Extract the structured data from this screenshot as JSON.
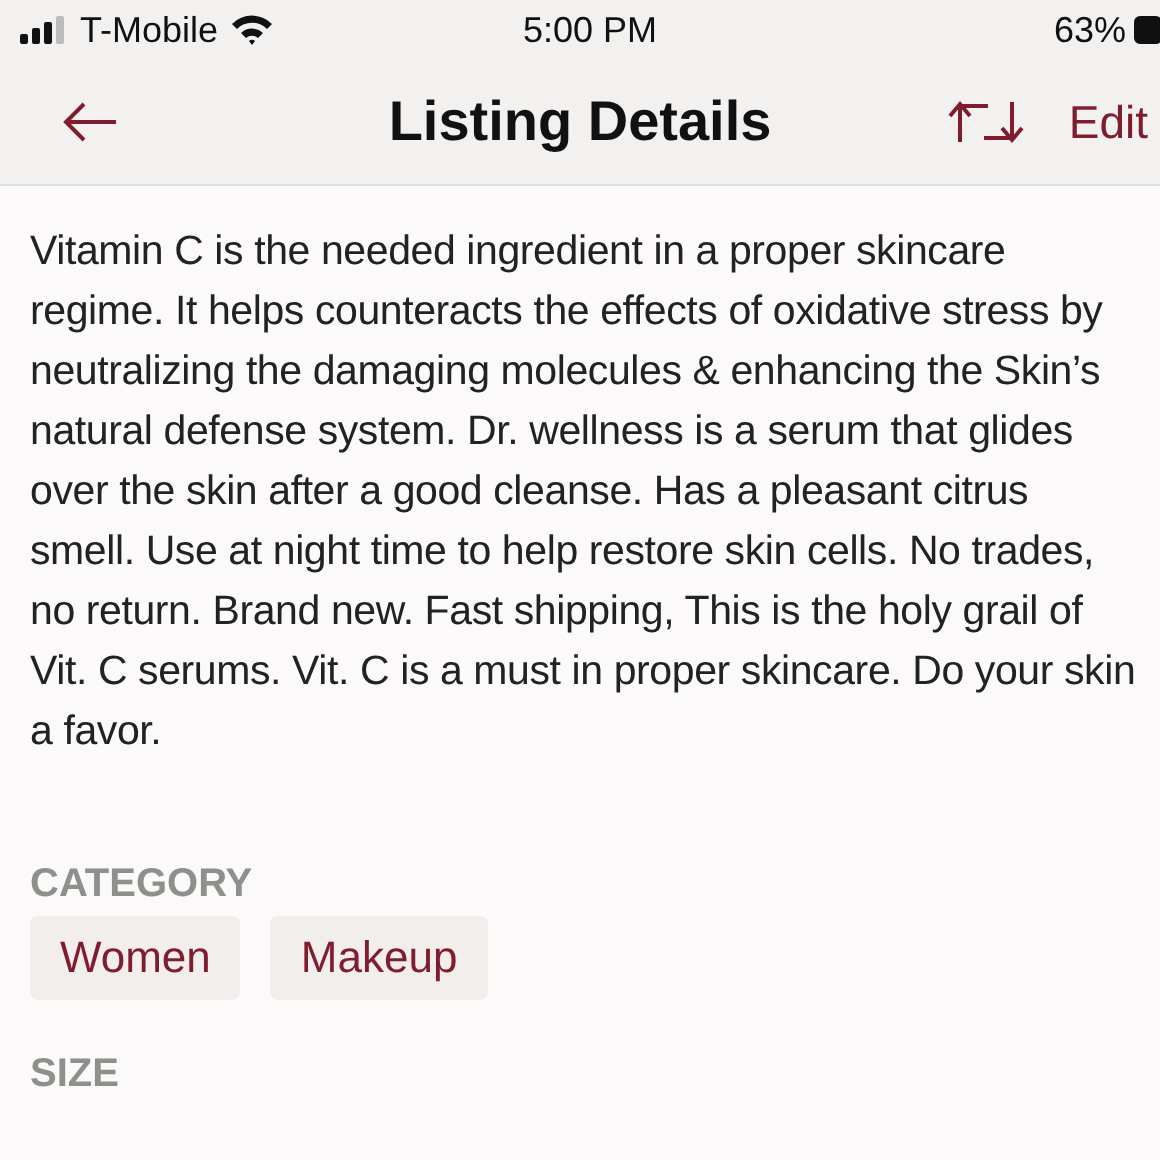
{
  "status_bar": {
    "carrier": "T-Mobile",
    "time": "5:00 PM",
    "battery": "63%"
  },
  "nav": {
    "title": "Listing Details",
    "action": "Edit"
  },
  "description": "Vitamin C is the needed ingredient in a proper skincare regime. It helps counteracts the effects of oxidative stress by neutralizing the damaging molecules & enhancing the Skin’s natural defense system. Dr. wellness is a serum that glides over the skin after a good cleanse. Has a pleasant citrus smell. Use at night time to help restore skin cells. No trades, no return. Brand new. Fast shipping,  This is the holy grail of Vit. C serums.  Vit. C is a must in proper skincare. Do your skin a favor.",
  "category": {
    "heading": "CATEGORY",
    "tags": [
      "Women",
      "Makeup"
    ]
  },
  "size": {
    "heading": "SIZE"
  }
}
